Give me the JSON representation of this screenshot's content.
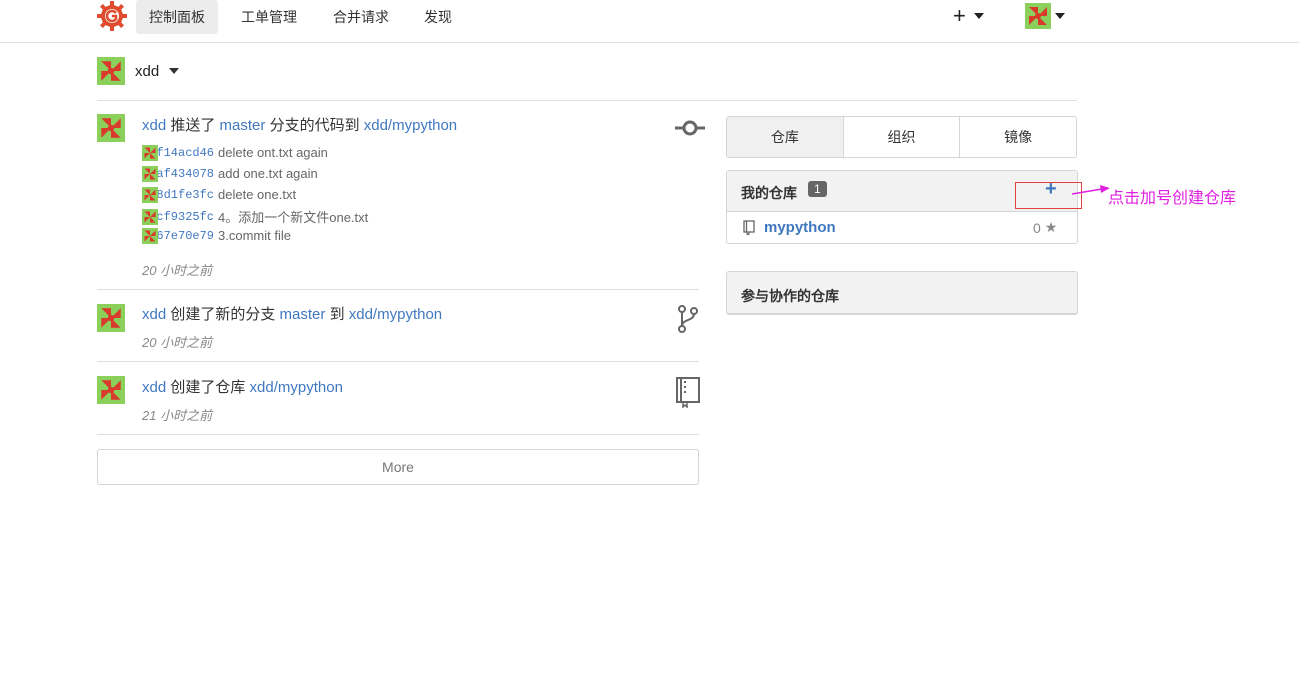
{
  "nav": {
    "items": [
      {
        "label": "控制面板",
        "active": true
      },
      {
        "label": "工单管理"
      },
      {
        "label": "合并请求"
      },
      {
        "label": "发现"
      }
    ],
    "plus_label": "+",
    "logo_icon": "gogs-logo-icon",
    "accent": "#e04c2f"
  },
  "context": {
    "name": "xdd"
  },
  "feed": {
    "items": [
      {
        "type": "push",
        "user": "xdd",
        "verb1": "推送了",
        "branch": "master",
        "verb2": "分支的代码到",
        "repo": "xdd/mypython",
        "commits": [
          {
            "sha": "f2f14acd46",
            "message": "delete ont.txt again"
          },
          {
            "sha": "fdaf434078",
            "message": "add one.txt again"
          },
          {
            "sha": "618d1fe3fc",
            "message": "delete one.txt"
          },
          {
            "sha": "cecf9325fc",
            "message": "4。添加一个新文件one.txt"
          },
          {
            "sha": "1367e70e79",
            "message": "3.commit file"
          }
        ],
        "time": "20 小时之前",
        "icon": "git-commit-icon"
      },
      {
        "type": "branch",
        "user": "xdd",
        "verb1": "创建了新的分支",
        "branch": "master",
        "verb2": "到",
        "repo": "xdd/mypython",
        "time": "20 小时之前",
        "icon": "git-branch-icon"
      },
      {
        "type": "create",
        "user": "xdd",
        "verb1": "创建了仓库",
        "repo": "xdd/mypython",
        "time": "21 小时之前",
        "icon": "repo-book-icon"
      }
    ],
    "more_label": "More"
  },
  "sidebar": {
    "tabs": [
      "仓库",
      "组织",
      "镜像"
    ],
    "my_repos": {
      "title": "我的仓库",
      "count": "1",
      "add_label": "+",
      "repos": [
        {
          "name": "mypython",
          "stars": "0"
        }
      ]
    },
    "collab": {
      "title": "参与协作的仓库"
    }
  },
  "annotation": {
    "text": "点击加号创建仓库",
    "color": "#e020e0",
    "box_color": "#e04040"
  }
}
